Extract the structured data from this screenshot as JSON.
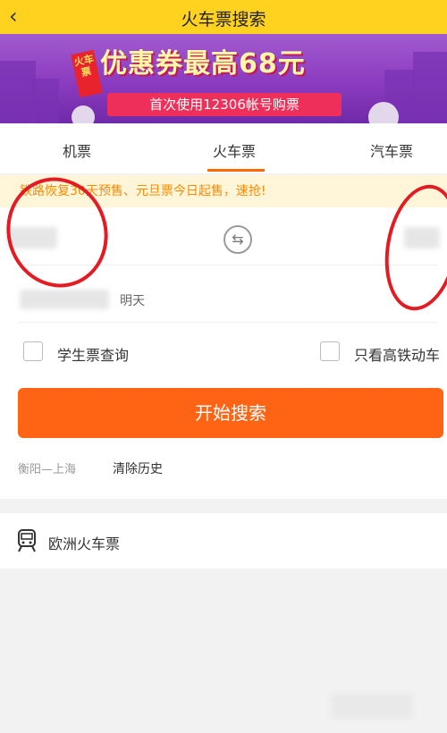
{
  "header": {
    "back_icon": "back-chevron-icon",
    "title": "火车票搜索"
  },
  "banner": {
    "tag": "火车票",
    "headline": "优惠券最高68元",
    "sub": "首次使用12306帐号购票",
    "colors": {
      "background": "#8b3bbf",
      "headline": "#fff6a6",
      "sub_bg": "#ed2f5a"
    }
  },
  "tabs": [
    {
      "label": "机票"
    },
    {
      "label": "火车票",
      "active": true
    },
    {
      "label": "汽车票"
    }
  ],
  "notice": {
    "text": "铁路恢复30天预售、元旦票今日起售，速抢!"
  },
  "form": {
    "swap_icon": "swap-arrows-icon",
    "date_suffix": "明天",
    "student_label": "学生票查询",
    "highspeed_label": "只看高铁动车",
    "search_button": "开始搜索",
    "history_item": "衡阳—上海",
    "clear_history": "清除历史"
  },
  "europe": {
    "icon": "train-icon",
    "label": "欧洲火车票"
  },
  "colors": {
    "header": "#ffd21f",
    "accent": "#ff6414",
    "annotation": "#e41b23"
  }
}
